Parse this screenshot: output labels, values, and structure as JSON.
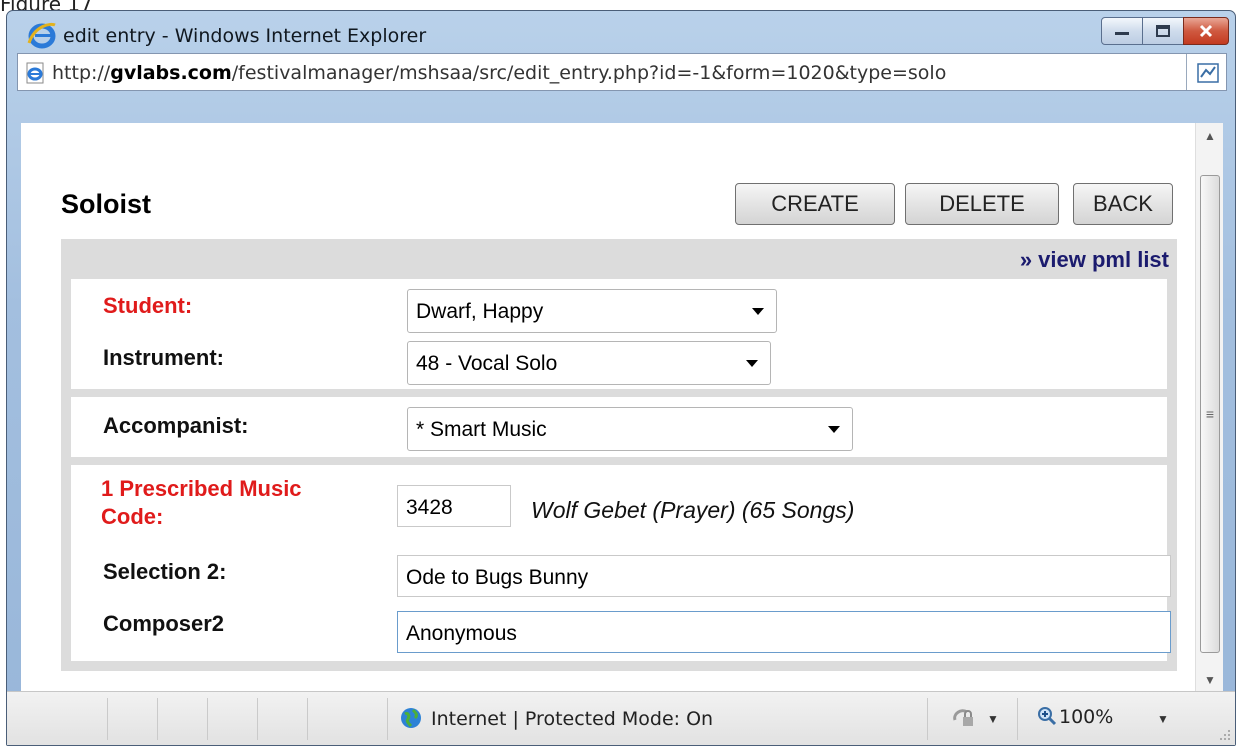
{
  "caption": "Figure 17",
  "window": {
    "title": "edit entry - Windows Internet Explorer",
    "controls": {
      "minimize": "minimize",
      "maximize": "maximize",
      "close": "close"
    }
  },
  "address": {
    "prefix": "http://",
    "domain": "gvlabs.com",
    "path": "/festivalmanager/mshsaa/src/edit_entry.php?id=-1&form=1020&type=solo"
  },
  "page": {
    "title": "Soloist",
    "buttons": {
      "create": "CREATE",
      "delete": "DELETE",
      "back": "BACK"
    },
    "pml_link": "» view pml list"
  },
  "form": {
    "student": {
      "label": "Student:",
      "value": "Dwarf, Happy"
    },
    "instrument": {
      "label": "Instrument:",
      "value": "48 - Vocal Solo"
    },
    "accompanist": {
      "label": "Accompanist:",
      "value": "* Smart Music"
    },
    "pml": {
      "label_line1": "1 Prescribed Music",
      "label_line2": "Code:",
      "code": "3428",
      "title": "Wolf Gebet (Prayer) (65 Songs)"
    },
    "selection2": {
      "label": "Selection 2:",
      "value": "Ode to Bugs Bunny"
    },
    "composer2": {
      "label": "Composer2",
      "value": "Anonymous"
    }
  },
  "statusbar": {
    "zone": "Internet | Protected Mode: On",
    "zoom": "100%"
  },
  "colors": {
    "required_label": "#e01b1b",
    "link": "#1b1b6e",
    "panel": "#dcdcdc"
  }
}
